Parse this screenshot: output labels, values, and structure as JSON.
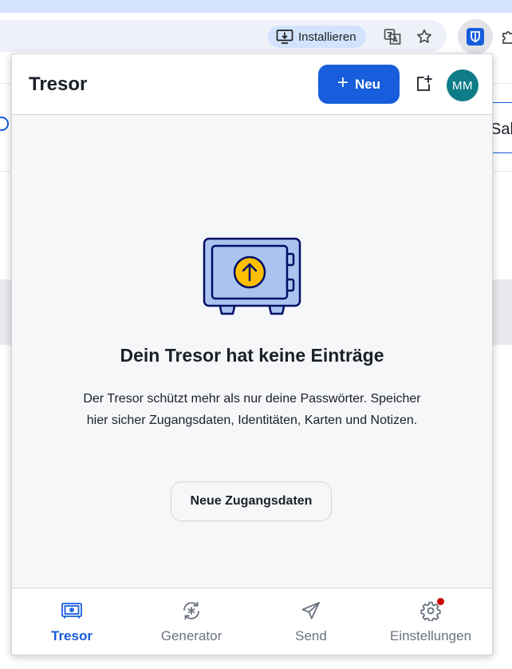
{
  "browser": {
    "install_label": "Installieren",
    "icons": [
      "install-app-icon",
      "translate-icon",
      "bookmark-star-icon",
      "bitwarden-extension-icon",
      "extensions-puzzle-icon"
    ]
  },
  "background_page": {
    "right_tab_text": "Sale"
  },
  "popup": {
    "title": "Tresor",
    "new_button_label": "Neu",
    "avatar_initials": "MM",
    "colors": {
      "primary": "#175ddc",
      "avatar": "#0e7c86",
      "safe_fill": "#aac3ef",
      "safe_stroke": "#020f66",
      "arrow_circle": "#ffbf00",
      "badge": "#c80000"
    }
  },
  "empty_state": {
    "title": "Dein Tresor hat keine Einträge",
    "description": "Der Tresor schützt mehr als nur deine Passwörter. Speicher hier sicher Zugangsdaten, Identitäten, Karten und Notizen.",
    "button_label": "Neue Zugangsdaten"
  },
  "nav": {
    "items": [
      {
        "label": "Tresor",
        "icon": "vault-icon",
        "active": true
      },
      {
        "label": "Generator",
        "icon": "generator-icon",
        "active": false
      },
      {
        "label": "Send",
        "icon": "send-icon",
        "active": false
      },
      {
        "label": "Einstellungen",
        "icon": "settings-gear-icon",
        "active": false,
        "badge": true
      }
    ]
  }
}
